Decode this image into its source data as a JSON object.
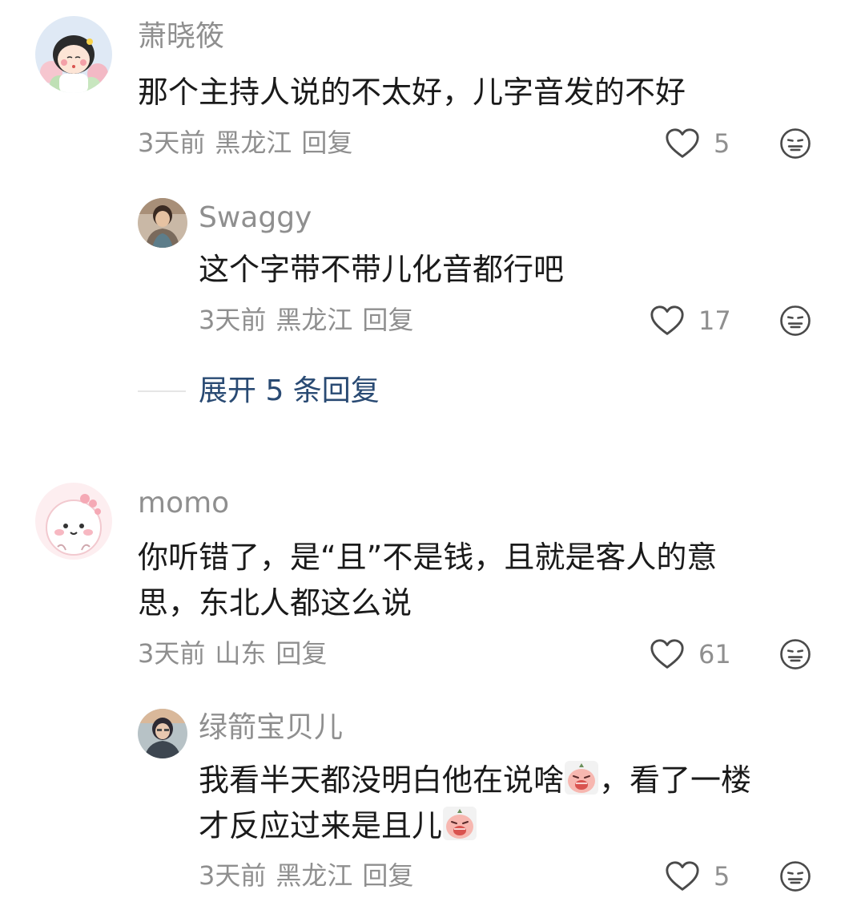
{
  "comments": [
    {
      "username": "萧晓筱",
      "text_lines": [
        "那个主持人说的不太好，儿字音发的不好"
      ],
      "time": "3天前",
      "location": "黑龙江",
      "reply_label": "回复",
      "likes": "5",
      "avatar_icon": "girl-cartoon-avatar"
    },
    {
      "username": "Swaggy",
      "text_lines": [
        "这个字带不带儿化音都行吧"
      ],
      "time": "3天前",
      "location": "黑龙江",
      "reply_label": "回复",
      "likes": "17",
      "avatar_icon": "photo-avatar"
    },
    {
      "username": "momo",
      "text_lines": [
        "你听错了，是“且”不是钱，且就是客人的意",
        "思，东北人都这么说"
      ],
      "time": "3天前",
      "location": "山东",
      "reply_label": "回复",
      "likes": "61",
      "avatar_icon": "pink-cartoon-avatar"
    },
    {
      "username": "绿箭宝贝儿",
      "text_lines_a": [
        "我看半天都没明白他在说啥",
        "，看了一楼"
      ],
      "text_lines_b": [
        "才反应过来是且儿"
      ],
      "time": "3天前",
      "location": "黑龙江",
      "reply_label": "回复",
      "likes": "5",
      "avatar_icon": "photo-avatar"
    }
  ],
  "expand": {
    "label": "展开 5 条回复"
  },
  "icons": {
    "like": "heart-icon",
    "dislike": "meh-face-icon",
    "emoji": "crying-emoji-icon"
  },
  "colors": {
    "username": "#8f8f8f",
    "text": "#1a1a1a",
    "meta": "#8f8f8f",
    "expand_link": "#294a73"
  }
}
